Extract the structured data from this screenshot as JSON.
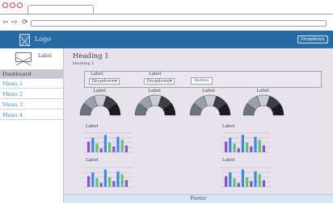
{
  "browser": {
    "back_icon": "arrow-left-icon",
    "forward_icon": "arrow-right-icon",
    "refresh_icon": "refresh-icon"
  },
  "header": {
    "logo_label": "Logo",
    "dropdown_label": "Dropdown"
  },
  "sidebar": {
    "profile_label": "Label",
    "items": [
      {
        "label": "Dashboard",
        "active": true
      },
      {
        "label": "Menu 1",
        "active": false
      },
      {
        "label": "Menu 2",
        "active": false
      },
      {
        "label": "Menu 3",
        "active": false
      },
      {
        "label": "Menu 4",
        "active": false
      }
    ]
  },
  "main": {
    "heading1": "Heading 1",
    "heading2": "Heading 2",
    "filters": {
      "label_1": "Label",
      "dropdown_1": "Dropdown",
      "label_2": "Label",
      "dropdown_2": "Dropdown",
      "button": "Button"
    },
    "gauges": [
      {
        "label": "Label"
      },
      {
        "label": "Label"
      },
      {
        "label": "Label"
      },
      {
        "label": "Label"
      }
    ],
    "charts": [
      {
        "label": "Label"
      },
      {
        "label": "Label"
      },
      {
        "label": "Label"
      },
      {
        "label": "Label"
      }
    ]
  },
  "footer": {
    "text": "Footer"
  },
  "colors": {
    "header_bg": "#286aa3",
    "main_bg": "#e8e2ec",
    "bar_purple": "#8d4fd2",
    "bar_blue": "#3e8ae0",
    "bar_green": "#5ec36a"
  }
}
